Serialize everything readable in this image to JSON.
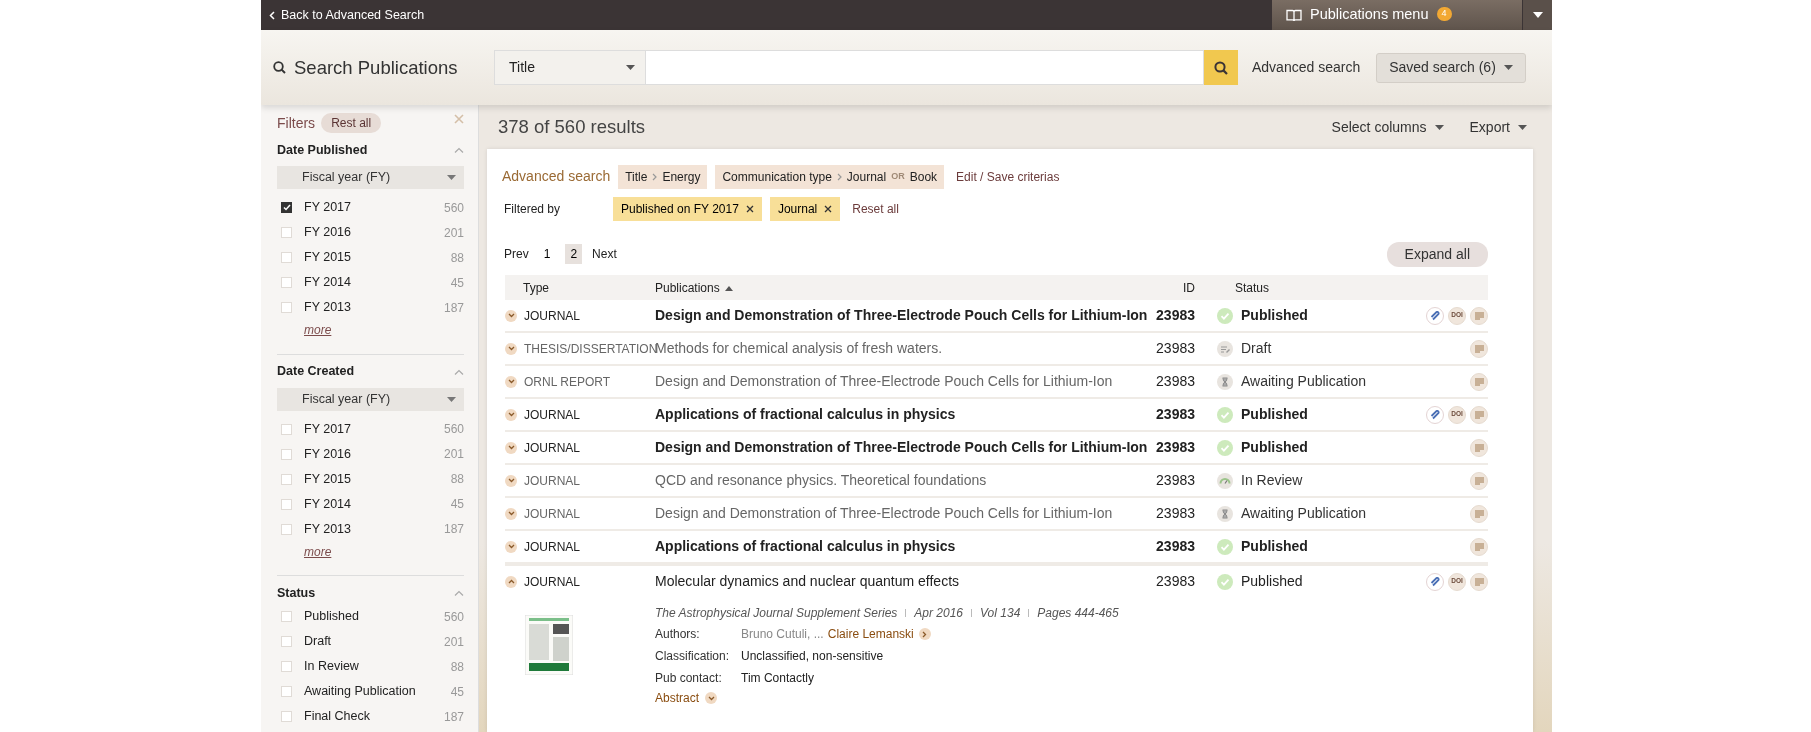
{
  "top_bar": {
    "back_link": "Back to Advanced Search",
    "menu": {
      "label": "Publications menu",
      "badge": "4"
    }
  },
  "search": {
    "title": "Search Publications",
    "field_select": "Title",
    "advanced_link": "Advanced search",
    "saved_search": "Saved search (6)"
  },
  "filters": {
    "title": "Filters",
    "reset": "Rest all",
    "sections": [
      {
        "title": "Date Published",
        "expanded": true,
        "select": "Fiscal year (FY)",
        "more": "more",
        "items": [
          {
            "label": "FY 2017",
            "count": "560",
            "checked": true
          },
          {
            "label": "FY 2016",
            "count": "201",
            "checked": false
          },
          {
            "label": "FY 2015",
            "count": "88",
            "checked": false
          },
          {
            "label": "FY 2014",
            "count": "45",
            "checked": false
          },
          {
            "label": "FY 2013",
            "count": "187",
            "checked": false
          }
        ]
      },
      {
        "title": "Date Created",
        "expanded": true,
        "select": "Fiscal year (FY)",
        "more": "more",
        "items": [
          {
            "label": "FY 2017",
            "count": "560",
            "checked": false
          },
          {
            "label": "FY 2016",
            "count": "201",
            "checked": false
          },
          {
            "label": "FY 2015",
            "count": "88",
            "checked": false
          },
          {
            "label": "FY 2014",
            "count": "45",
            "checked": false
          },
          {
            "label": "FY 2013",
            "count": "187",
            "checked": false
          }
        ]
      },
      {
        "title": "Status",
        "expanded": true,
        "items": [
          {
            "label": "Published",
            "count": "560",
            "checked": false
          },
          {
            "label": "Draft",
            "count": "201",
            "checked": false
          },
          {
            "label": "In Review",
            "count": "88",
            "checked": false
          },
          {
            "label": "Awaiting Publication",
            "count": "45",
            "checked": false
          },
          {
            "label": "Final Check",
            "count": "187",
            "checked": false
          }
        ]
      }
    ]
  },
  "results": {
    "summary": "378 of 560 results",
    "select_columns": "Select columns",
    "export": "Export"
  },
  "criteria": {
    "label": "Advanced search",
    "chips": [
      {
        "field": "Title",
        "values": [
          "Energy"
        ]
      },
      {
        "field": "Communication type",
        "values": [
          "Journal",
          "Book"
        ],
        "joiner": "OR"
      }
    ],
    "edit_link": "Edit / Save criterias"
  },
  "filtered_by": {
    "label": "Filtered by",
    "chips": [
      "Published on FY 2017",
      "Journal"
    ],
    "reset": "Reset all"
  },
  "pagination": {
    "prev": "Prev",
    "pages": [
      {
        "label": "1",
        "selected": false
      },
      {
        "label": "2",
        "selected": true
      }
    ],
    "next": "Next"
  },
  "expand_all": "Expand all",
  "table": {
    "columns": [
      {
        "label": "Type"
      },
      {
        "label": "Publications",
        "sorted_ascending": true
      },
      {
        "label": "ID"
      },
      {
        "label": "Status"
      }
    ],
    "rows": [
      {
        "type": "JOURNAL",
        "title": "Design and Demonstration of Three-Electrode Pouch Cells for Lithium-Ion",
        "id": "23983",
        "status": {
          "label": "Published",
          "kind": "published"
        },
        "kind": "highlighted",
        "expanded": false,
        "actions": [
          {
            "kind": "link"
          },
          {
            "kind": "doi",
            "label": "DOI"
          },
          {
            "kind": "details"
          }
        ]
      },
      {
        "type": "THESIS/DISSERTATION",
        "title": "Methods for chemical analysis of fresh waters.",
        "id": "23983",
        "status": {
          "label": "Draft",
          "kind": "draft"
        },
        "kind": "muted",
        "expanded": false,
        "actions": [
          {
            "kind": "details"
          }
        ]
      },
      {
        "type": "ORNL REPORT",
        "title": "Design and Demonstration of Three-Electrode Pouch Cells for Lithium-Ion",
        "id": "23983",
        "status": {
          "label": "Awaiting Publication",
          "kind": "awaiting"
        },
        "kind": "muted",
        "expanded": false,
        "actions": [
          {
            "kind": "details"
          }
        ]
      },
      {
        "type": "JOURNAL",
        "title": "Applications of fractional calculus in physics",
        "id": "23983",
        "status": {
          "label": "Published",
          "kind": "published"
        },
        "kind": "highlighted",
        "expanded": false,
        "actions": [
          {
            "kind": "link"
          },
          {
            "kind": "doi",
            "label": "DOI"
          },
          {
            "kind": "details"
          }
        ]
      },
      {
        "type": "JOURNAL",
        "title": "Design and Demonstration of Three-Electrode Pouch Cells for Lithium-Ion",
        "id": "23983",
        "status": {
          "label": "Published",
          "kind": "published"
        },
        "kind": "highlighted",
        "expanded": false,
        "actions": [
          {
            "kind": "details"
          }
        ]
      },
      {
        "type": "JOURNAL",
        "title": "QCD and resonance physics. Theoretical foundations",
        "id": "23983",
        "status": {
          "label": "In Review",
          "kind": "review"
        },
        "kind": "muted",
        "expanded": false,
        "actions": [
          {
            "kind": "details"
          }
        ]
      },
      {
        "type": "JOURNAL",
        "title": "Design and Demonstration of Three-Electrode Pouch Cells for Lithium-Ion",
        "id": "23983",
        "status": {
          "label": "Awaiting Publication",
          "kind": "awaiting"
        },
        "kind": "muted",
        "expanded": false,
        "actions": [
          {
            "kind": "details"
          }
        ]
      },
      {
        "type": "JOURNAL",
        "title": "Applications of fractional calculus in physics",
        "id": "23983",
        "status": {
          "label": "Published",
          "kind": "published"
        },
        "kind": "highlighted",
        "expanded": false,
        "actions": [
          {
            "kind": "details"
          }
        ]
      },
      {
        "type": "JOURNAL",
        "title": "Molecular dynamics and nuclear quantum effects",
        "id": "23983",
        "status": {
          "label": "Published",
          "kind": "published"
        },
        "kind": "plain",
        "expanded": true,
        "actions": [
          {
            "kind": "link"
          },
          {
            "kind": "doi",
            "label": "DOI"
          },
          {
            "kind": "details"
          }
        ],
        "details": {
          "journal": "The Astrophysical Journal Supplement Series",
          "meta": [
            "Apr 2016",
            "Vol 134",
            "Pages 444-465"
          ],
          "fields": [
            {
              "label": "Authors:",
              "value": "Bruno Cutuli, ...",
              "link": "Claire Lemanski"
            },
            {
              "label": "Classification:",
              "value": "Unclassified, non-sensitive"
            },
            {
              "label": "Pub contact:",
              "value": "Tim Contactly"
            }
          ],
          "abstract": "Abstract"
        }
      }
    ]
  }
}
